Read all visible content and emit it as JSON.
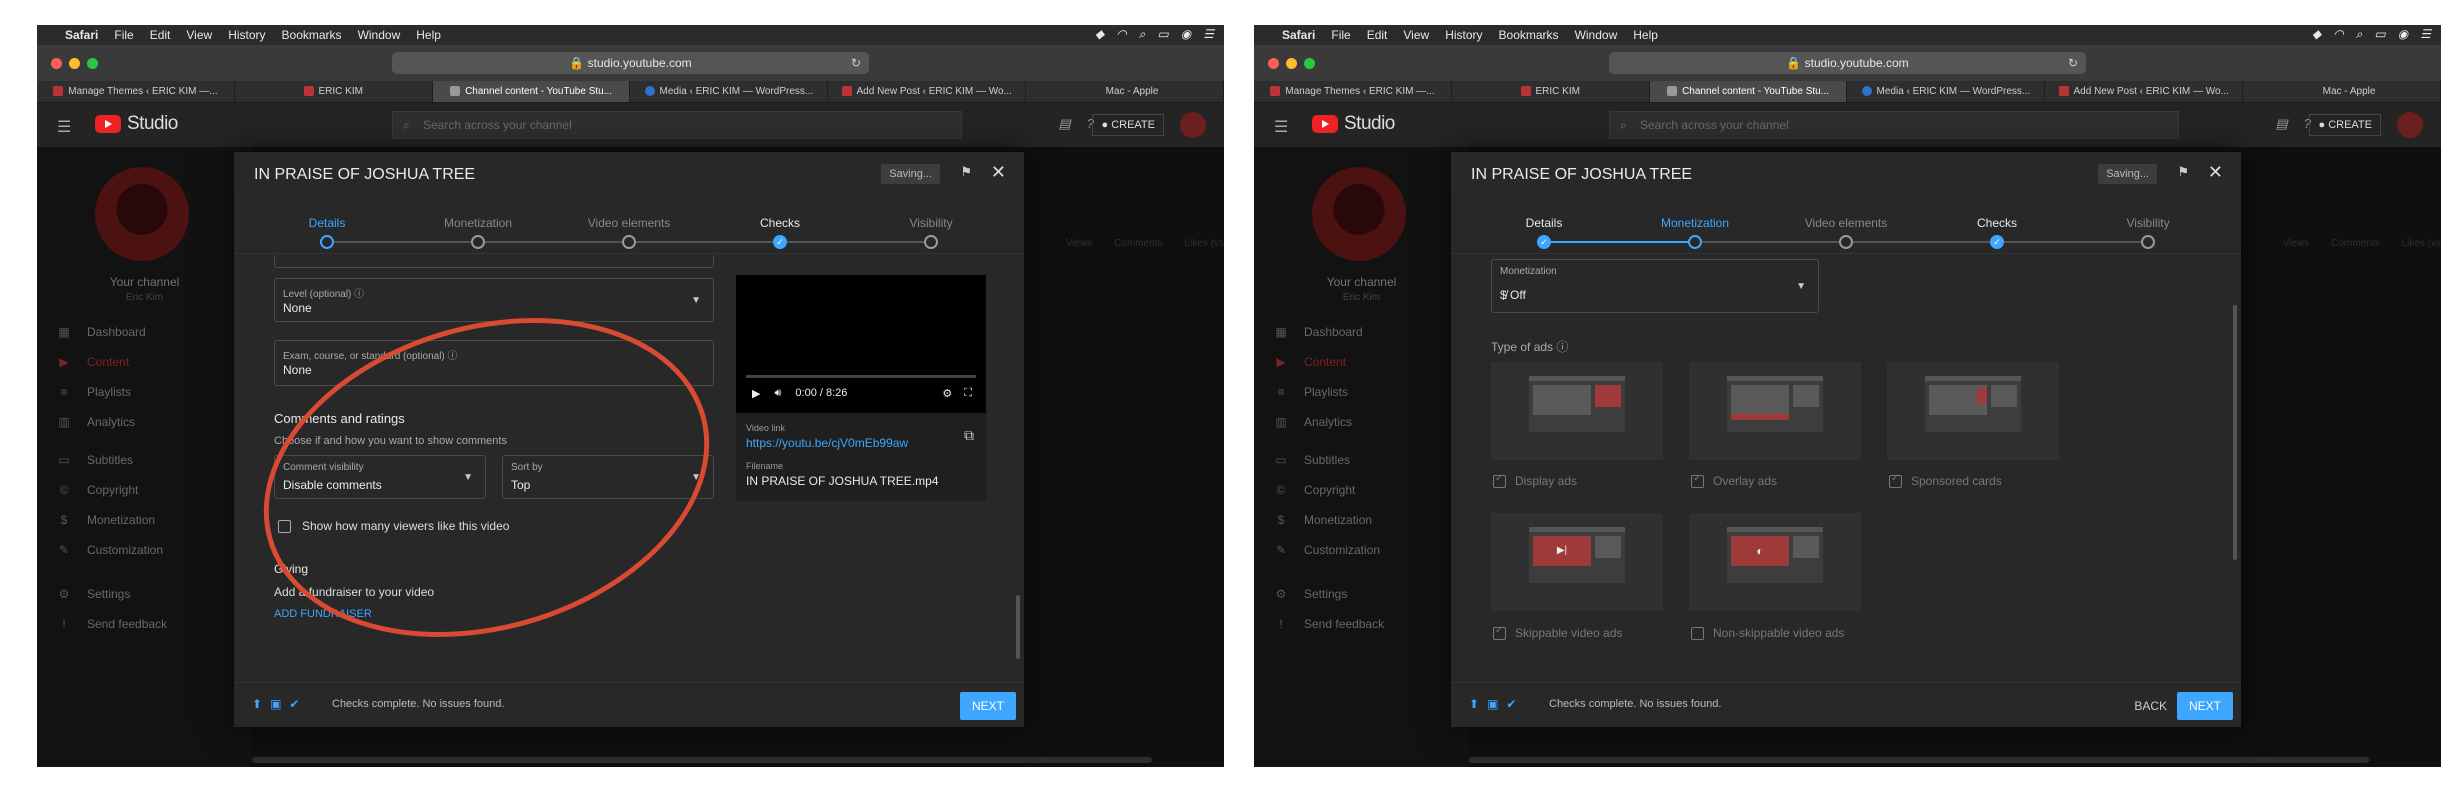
{
  "menubar": {
    "apple": "",
    "app": "Safari",
    "items": [
      "File",
      "Edit",
      "View",
      "History",
      "Bookmarks",
      "Window",
      "Help"
    ]
  },
  "browser": {
    "url": "studio.youtube.com"
  },
  "tabs": [
    "Manage Themes ‹ ERIC KIM —...",
    "ERIC KIM",
    "Channel content - YouTube Stu...",
    "Media ‹ ERIC KIM — WordPress...",
    "Add New Post ‹ ERIC KIM — Wo...",
    "Mac - Apple"
  ],
  "header": {
    "logo": "Studio",
    "search_placeholder": "Search across your channel",
    "create": "CREATE"
  },
  "sidebar": {
    "channel_label": "Your channel",
    "channel_name": "Eric Kim",
    "items": [
      {
        "label": "Dashboard",
        "icon": "dashboard-icon"
      },
      {
        "label": "Content",
        "icon": "content-icon"
      },
      {
        "label": "Playlists",
        "icon": "playlists-icon"
      },
      {
        "label": "Analytics",
        "icon": "analytics-icon"
      },
      {
        "label": "Subtitles",
        "icon": "subtitles-icon"
      },
      {
        "label": "Copyright",
        "icon": "copyright-icon"
      },
      {
        "label": "Monetization",
        "icon": "dollar-icon"
      },
      {
        "label": "Customization",
        "icon": "wand-icon"
      },
      {
        "label": "Settings",
        "icon": "gear-icon"
      },
      {
        "label": "Send feedback",
        "icon": "feedback-icon"
      }
    ]
  },
  "columns": [
    "Views",
    "Comments",
    "Likes (vs"
  ],
  "dialog": {
    "title": "IN PRAISE OF JOSHUA TREE",
    "saving": "Saving...",
    "steps": [
      "Details",
      "Monetization",
      "Video elements",
      "Checks",
      "Visibility"
    ],
    "footer_text": "Checks complete. No issues found.",
    "next": "NEXT",
    "back": "BACK"
  },
  "details": {
    "level_label": "Level (optional)",
    "level_value": "None",
    "exam_label": "Exam, course, or standard (optional)",
    "exam_value": "None",
    "comments_title": "Comments and ratings",
    "comments_sub": "Choose if and how you want to show comments",
    "visibility_label": "Comment visibility",
    "visibility_value": "Disable comments",
    "sort_label": "Sort by",
    "sort_value": "Top",
    "likes_check": "Show how many viewers like this video",
    "giving_title": "Giving",
    "giving_sub": "Add a fundraiser to your video",
    "giving_link": "ADD FUNDRAISER"
  },
  "video": {
    "time": "0:00 / 8:26",
    "link_label": "Video link",
    "link": "https://youtu.be/cjV0mEb99aw",
    "file_label": "Filename",
    "file": "IN PRAISE OF JOSHUA TREE.mp4"
  },
  "monetization": {
    "label": "Monetization",
    "value": "Off",
    "ads_title": "Type of ads",
    "ads": [
      {
        "label": "Display ads",
        "checked": true
      },
      {
        "label": "Overlay ads",
        "checked": true
      },
      {
        "label": "Sponsored cards",
        "checked": true
      },
      {
        "label": "Skippable video ads",
        "checked": true
      },
      {
        "label": "Non-skippable video ads",
        "checked": false
      }
    ]
  }
}
